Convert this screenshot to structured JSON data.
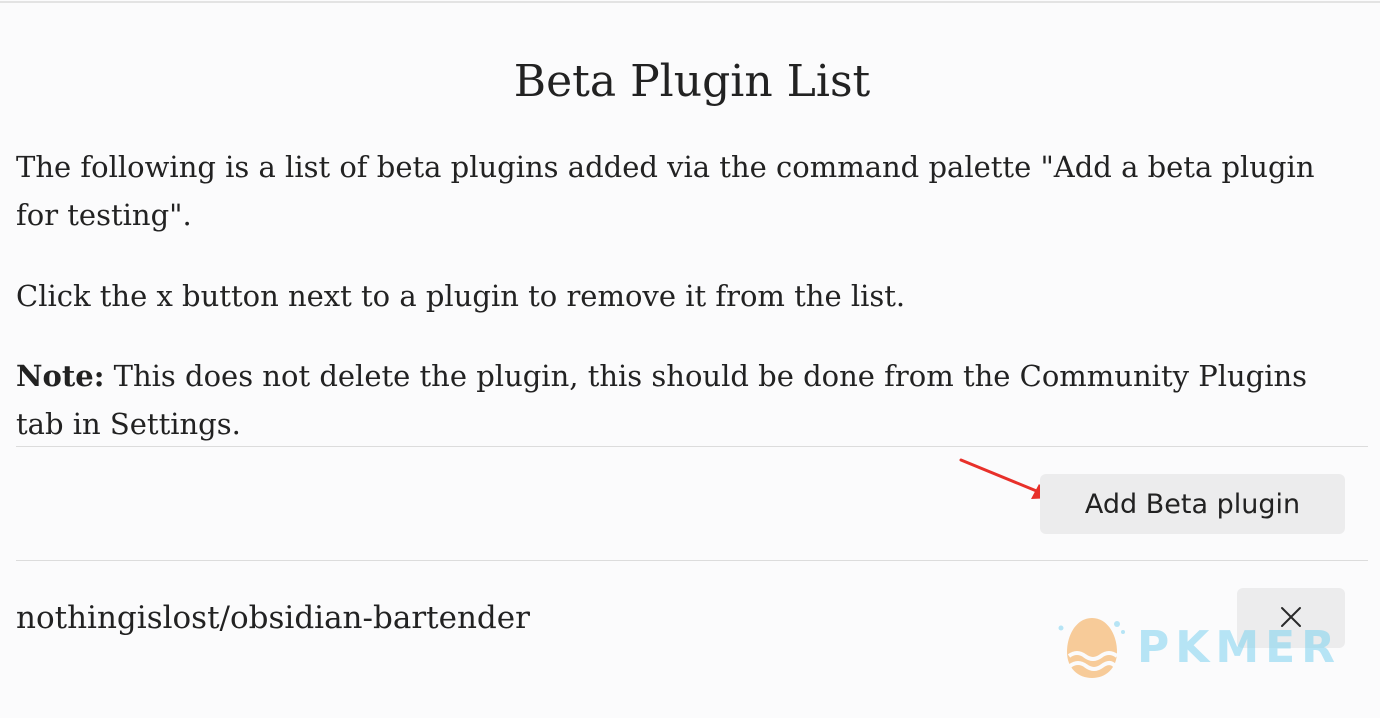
{
  "modal": {
    "title": "Beta Plugin List",
    "intro": "The following is a list of beta plugins added via the command palette \"Add a beta plugin for testing\".",
    "instruction": "Click the x button next to a plugin to remove it from the list.",
    "note_label": "Note:",
    "note_text": " This does not delete the plugin, this should be done from the Community Plugins tab in Settings.",
    "add_button_label": "Add Beta plugin"
  },
  "plugins": [
    {
      "name": "nothingislost/obsidian-bartender",
      "remove_icon": "close-icon"
    }
  ],
  "annotation": {
    "arrow_color": "#e8302a"
  },
  "watermark": {
    "text": "PKMER",
    "color": "#7fd3f0"
  }
}
